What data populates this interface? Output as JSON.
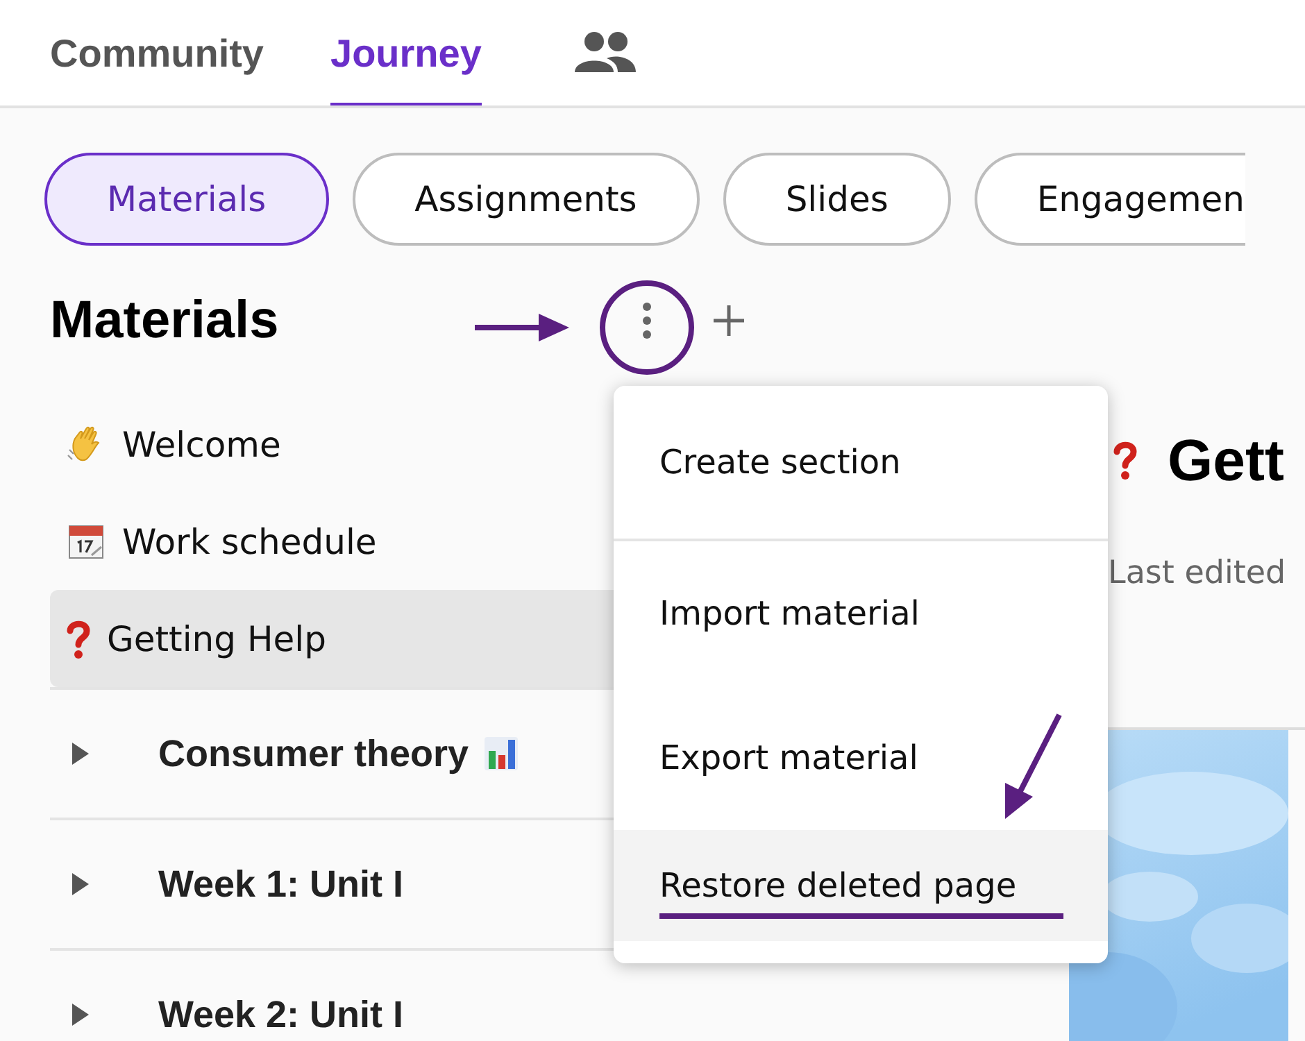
{
  "header_tabs": [
    {
      "kind": "text",
      "label": "Community",
      "selected": false
    },
    {
      "kind": "text",
      "label": "Journey",
      "selected": true
    },
    {
      "kind": "people",
      "selected": false
    }
  ],
  "filter_pills": [
    {
      "label": "Materials",
      "selected": true
    },
    {
      "label": "Assignments",
      "selected": false
    },
    {
      "label": "Slides",
      "selected": false
    },
    {
      "label": "Engagemen",
      "selected": false,
      "cut": true
    }
  ],
  "materials": {
    "title": "Materials",
    "pages": [
      {
        "kind": "wave",
        "label": "Welcome",
        "selected": false
      },
      {
        "kind": "calendar",
        "label": "Work schedule",
        "selected": false
      },
      {
        "kind": "question",
        "label": "Getting Help",
        "selected": true
      }
    ],
    "sections": [
      {
        "kind": "chart",
        "label": "Consumer theory",
        "expanded": false
      },
      {
        "kind": "plain",
        "label": "Week 1: Unit I",
        "expanded": false
      },
      {
        "kind": "plain",
        "label": "Week 2: Unit I",
        "expanded": false
      }
    ]
  },
  "menu": {
    "items": [
      {
        "label": "Create section",
        "selected": false,
        "separator_below": true
      },
      {
        "label": "Import material",
        "selected": false,
        "separator_below": false
      },
      {
        "label": "Export material",
        "selected": false,
        "separator_below": false
      },
      {
        "label": "Restore deleted page",
        "selected": true,
        "separator_below": false
      }
    ]
  },
  "page": {
    "title": "Gett",
    "meta": "Last edited"
  }
}
